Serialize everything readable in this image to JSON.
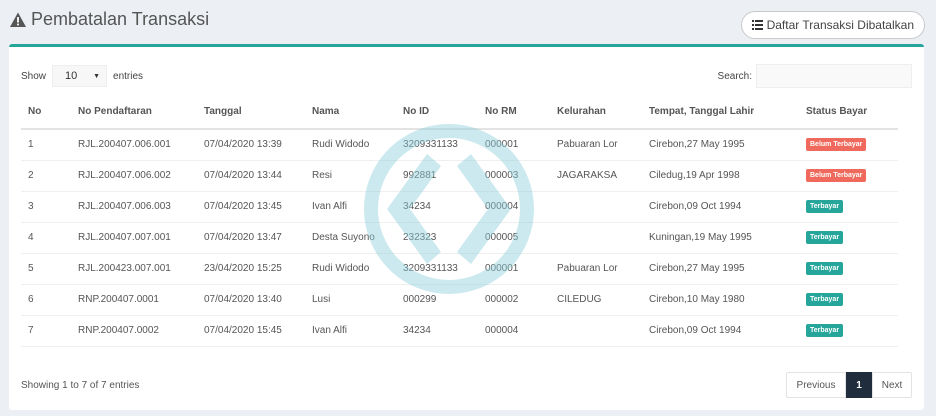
{
  "header": {
    "title": "Pembatalan Transaksi",
    "list_button_label": "Daftar Transaksi Dibatalkan"
  },
  "controls": {
    "show_label": "Show",
    "length_value": "10",
    "entries_label": "entries",
    "search_label": "Search:",
    "search_value": ""
  },
  "table": {
    "columns": [
      "No",
      "No Pendaftaran",
      "Tanggal",
      "Nama",
      "No ID",
      "No RM",
      "Kelurahan",
      "Tempat, Tanggal Lahir",
      "Status Bayar"
    ],
    "rows": [
      {
        "no": "1",
        "reg": "RJL.200407.006.001",
        "date": "07/04/2020 13:39",
        "name": "Rudi Widodo",
        "id": "3209331133",
        "rm": "000001",
        "kel": "Pabuaran Lor",
        "ttl": "Cirebon,27 May 1995",
        "status": "Belum Terbayar",
        "paid": false
      },
      {
        "no": "2",
        "reg": "RJL.200407.006.002",
        "date": "07/04/2020 13:44",
        "name": "Resi",
        "id": "992881",
        "rm": "000003",
        "kel": "JAGARAKSA",
        "ttl": "Ciledug,19 Apr 1998",
        "status": "Belum Terbayar",
        "paid": false
      },
      {
        "no": "3",
        "reg": "RJL.200407.006.003",
        "date": "07/04/2020 13:45",
        "name": "Ivan Alfi",
        "id": "34234",
        "rm": "000004",
        "kel": "",
        "ttl": "Cirebon,09 Oct 1994",
        "status": "Terbayar",
        "paid": true
      },
      {
        "no": "4",
        "reg": "RJL.200407.007.001",
        "date": "07/04/2020 13:47",
        "name": "Desta Suyono",
        "id": "232323",
        "rm": "000005",
        "kel": "",
        "ttl": "Kuningan,19 May 1995",
        "status": "Terbayar",
        "paid": true
      },
      {
        "no": "5",
        "reg": "RJL.200423.007.001",
        "date": "23/04/2020 15:25",
        "name": "Rudi Widodo",
        "id": "3209331133",
        "rm": "000001",
        "kel": "Pabuaran Lor",
        "ttl": "Cirebon,27 May 1995",
        "status": "Terbayar",
        "paid": true
      },
      {
        "no": "6",
        "reg": "RNP.200407.0001",
        "date": "07/04/2020 13:40",
        "name": "Lusi",
        "id": "000299",
        "rm": "000002",
        "kel": "CILEDUG",
        "ttl": "Cirebon,10 May 1980",
        "status": "Terbayar",
        "paid": true
      },
      {
        "no": "7",
        "reg": "RNP.200407.0002",
        "date": "07/04/2020 15:45",
        "name": "Ivan Alfi",
        "id": "34234",
        "rm": "000004",
        "kel": "",
        "ttl": "Cirebon,09 Oct 1994",
        "status": "Terbayar",
        "paid": true
      }
    ]
  },
  "footer": {
    "info": "Showing 1 to 7 of 7 entries",
    "prev_label": "Previous",
    "current_page": "1",
    "next_label": "Next"
  },
  "colors": {
    "accent": "#26a69a",
    "unpaid": "#ef6a5c",
    "paid": "#26a69a",
    "active_page": "#1f2d3d"
  },
  "icons": {
    "title": "warning-icon",
    "list_button": "list-icon",
    "watermark": "code-arrows-icon"
  }
}
